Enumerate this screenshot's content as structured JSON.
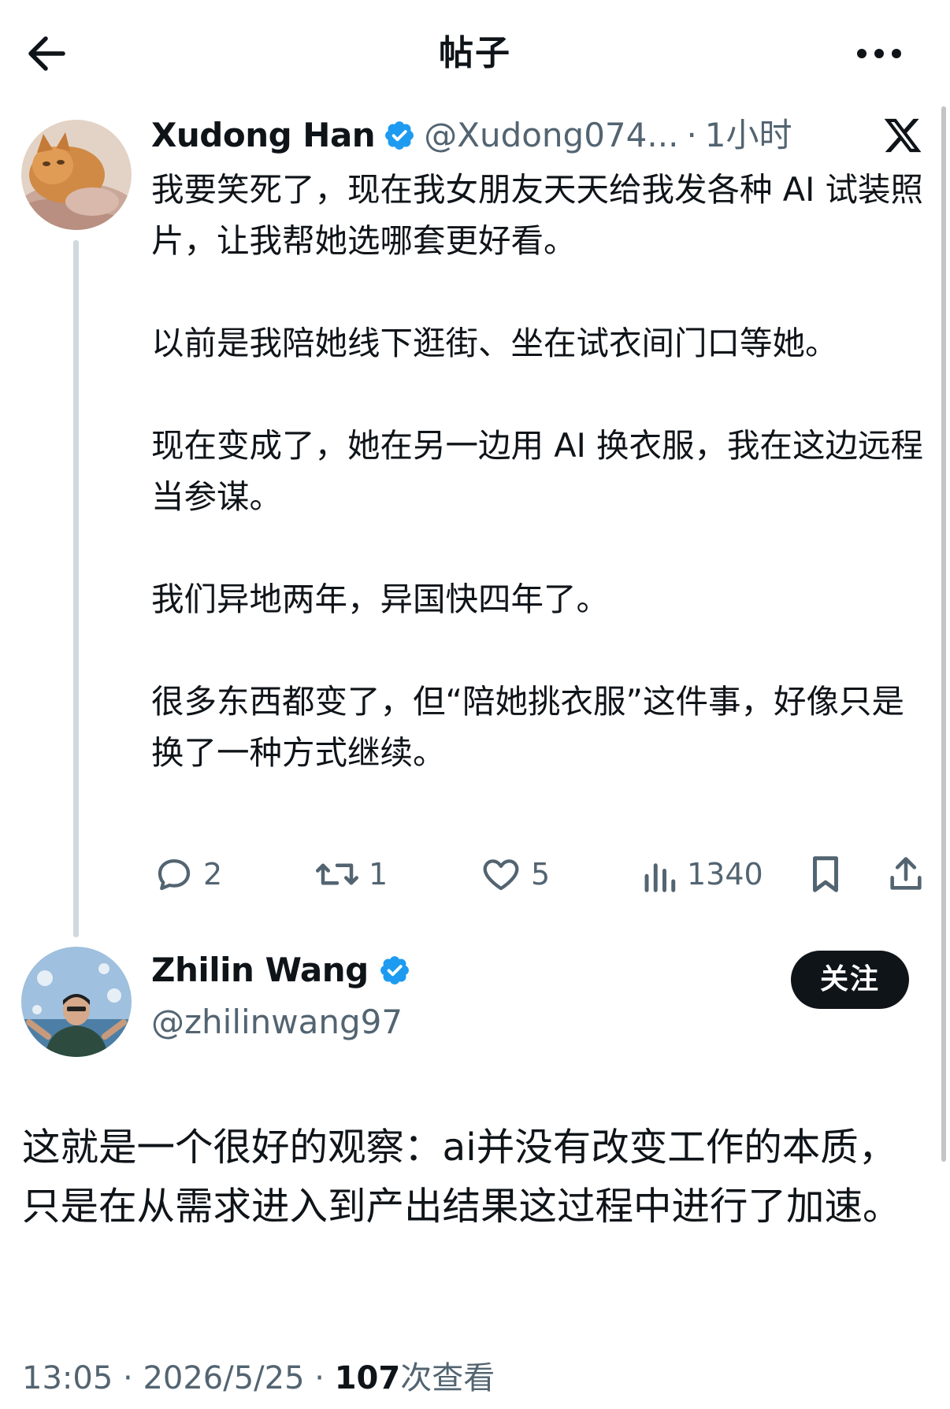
{
  "header": {
    "title": "帖子"
  },
  "original_post": {
    "author_name": "Xudong Han",
    "handle": "@Xudong074...",
    "separator": "·",
    "time_ago": "1小时",
    "paragraphs": [
      "我要笑死了，现在我女朋友天天给我发各种 AI 试装照片，让我帮她选哪套更好看。",
      "以前是我陪她线下逛街、坐在试衣间门口等她。",
      "现在变成了，她在另一边用 AI 换衣服，我在这边远程当参谋。",
      "我们异地两年，异国快四年了。",
      "很多东西都变了，但“陪她挑衣服”这件事，好像只是换了一种方式继续。"
    ],
    "actions": {
      "replies": "2",
      "reposts": "1",
      "likes": "5",
      "views": "1340"
    }
  },
  "reply_post": {
    "author_name": "Zhilin Wang",
    "handle": "@zhilinwang97",
    "follow_label": "关注",
    "text": "这就是一个很好的观察：ai并没有改变工作的本质，只是在从需求进入到产出结果这过程中进行了加速。",
    "time": "13:05",
    "dot1": "·",
    "date": "2026/5/25",
    "dot2": "·",
    "view_count": "107",
    "view_label": "次查看"
  },
  "colors": {
    "text": "#0f1419",
    "secondary": "#536471",
    "verified": "#1d9bf0",
    "thread_line": "#cfd9de"
  },
  "icons": {
    "back": "arrow-left-icon",
    "more": "more-dots-icon",
    "x_logo": "x-logo-icon",
    "verified": "verified-badge-icon",
    "reply": "comment-bubble-icon",
    "repost": "repost-icon",
    "like": "heart-icon",
    "views": "bar-chart-icon",
    "bookmark": "bookmark-icon",
    "share": "share-upload-icon"
  }
}
